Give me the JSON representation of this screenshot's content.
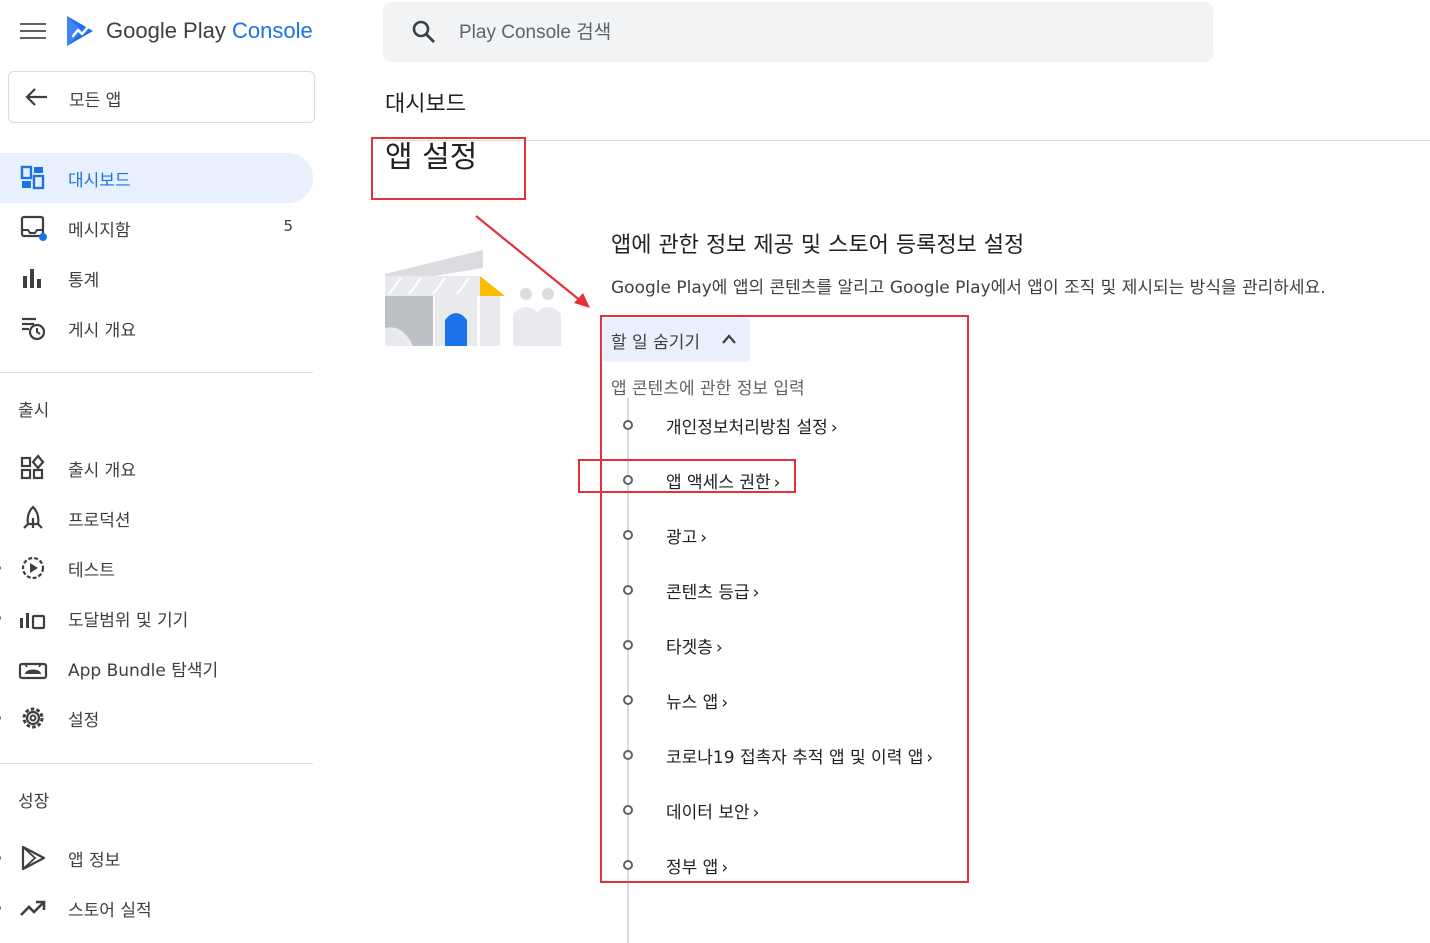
{
  "brand": {
    "prefix": "Google Play",
    "accent": "Console"
  },
  "all_apps": {
    "label": "모든 앱"
  },
  "sidebar": {
    "top_items": [
      {
        "label": "대시보드",
        "icon": "dashboard-icon",
        "active": true
      },
      {
        "label": "메시지함",
        "icon": "inbox-icon",
        "badge": "5"
      },
      {
        "label": "통계",
        "icon": "bar-chart-icon"
      },
      {
        "label": "게시 개요",
        "icon": "publishing-icon"
      }
    ],
    "release_header": "출시",
    "release_items": [
      {
        "label": "출시 개요",
        "icon": "release-overview-icon"
      },
      {
        "label": "프로덕션",
        "icon": "production-icon"
      },
      {
        "label": "테스트",
        "icon": "testing-icon"
      },
      {
        "label": "도달범위 및 기기",
        "icon": "reach-devices-icon"
      },
      {
        "label": "App Bundle 탐색기",
        "icon": "android-icon"
      },
      {
        "label": "설정",
        "icon": "gear-icon"
      }
    ],
    "grow_header": "성장",
    "grow_items": [
      {
        "label": "앱 정보",
        "icon": "play-icon"
      },
      {
        "label": "스토어 실적",
        "icon": "trending-icon"
      }
    ]
  },
  "search": {
    "placeholder": "Play Console 검색"
  },
  "main": {
    "page_title": "대시보드",
    "section_title": "앱 설정",
    "card_title": "앱에 관한 정보 제공 및 스토어 등록정보 설정",
    "card_desc": "Google Play에 앱의 콘텐츠를 알리고 Google Play에서 앱이 조직 및 제시되는 방식을 관리하세요.",
    "hide_button": "할 일 숨기기",
    "task_header": "앱 콘텐츠에 관한 정보 입력",
    "tasks": [
      "개인정보처리방침 설정",
      "앱 액세스 권한",
      "광고",
      "콘텐츠 등급",
      "타겟층",
      "뉴스 앱",
      "코로나19 접촉자 추적 앱 및 이력 앱",
      "데이터 보안",
      "정부 앱"
    ],
    "task_arrow": "›"
  },
  "colors": {
    "accent": "#1a73e8",
    "active_bg": "#e8f0fe",
    "annotation": "#e53238"
  }
}
